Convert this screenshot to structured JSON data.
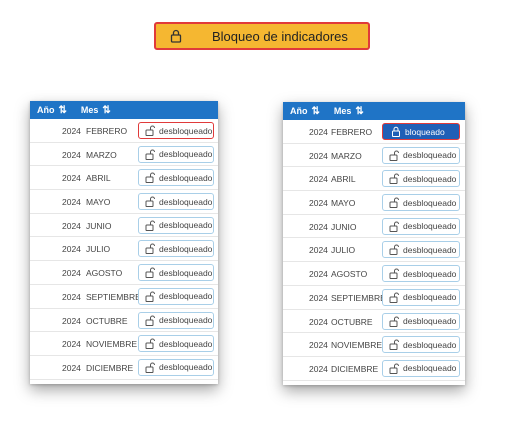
{
  "top_button": {
    "label": "Bloqueo de indicadores",
    "icon": "lock-icon",
    "bg": "#f5b731"
  },
  "headers": {
    "year": "Año",
    "month": "Mes"
  },
  "left_panel": {
    "rows": [
      {
        "year": "2024",
        "month": "FEBRERO",
        "status": "desbloqueado"
      },
      {
        "year": "2024",
        "month": "MARZO",
        "status": "desbloqueado"
      },
      {
        "year": "2024",
        "month": "ABRIL",
        "status": "desbloqueado"
      },
      {
        "year": "2024",
        "month": "MAYO",
        "status": "desbloqueado"
      },
      {
        "year": "2024",
        "month": "JUNIO",
        "status": "desbloqueado"
      },
      {
        "year": "2024",
        "month": "JULIO",
        "status": "desbloqueado"
      },
      {
        "year": "2024",
        "month": "AGOSTO",
        "status": "desbloqueado"
      },
      {
        "year": "2024",
        "month": "SEPTIEMBRE",
        "status": "desbloqueado"
      },
      {
        "year": "2024",
        "month": "OCTUBRE",
        "status": "desbloqueado"
      },
      {
        "year": "2024",
        "month": "NOVIEMBRE",
        "status": "desbloqueado"
      },
      {
        "year": "2024",
        "month": "DICIEMBRE",
        "status": "desbloqueado"
      }
    ]
  },
  "right_panel": {
    "rows": [
      {
        "year": "2024",
        "month": "FEBRERO",
        "status": "bloqueado"
      },
      {
        "year": "2024",
        "month": "MARZO",
        "status": "desbloqueado"
      },
      {
        "year": "2024",
        "month": "ABRIL",
        "status": "desbloqueado"
      },
      {
        "year": "2024",
        "month": "MAYO",
        "status": "desbloqueado"
      },
      {
        "year": "2024",
        "month": "JUNIO",
        "status": "desbloqueado"
      },
      {
        "year": "2024",
        "month": "JULIO",
        "status": "desbloqueado"
      },
      {
        "year": "2024",
        "month": "AGOSTO",
        "status": "desbloqueado"
      },
      {
        "year": "2024",
        "month": "SEPTIEMBRE",
        "status": "desbloqueado"
      },
      {
        "year": "2024",
        "month": "OCTUBRE",
        "status": "desbloqueado"
      },
      {
        "year": "2024",
        "month": "NOVIEMBRE",
        "status": "desbloqueado"
      },
      {
        "year": "2024",
        "month": "DICIEMBRE",
        "status": "desbloqueado"
      }
    ]
  },
  "colors": {
    "header_bg": "#1f74c6",
    "locked_bg": "#1f5fb6",
    "highlight": "#e03a3a",
    "pill_border": "#a9cfe8"
  }
}
